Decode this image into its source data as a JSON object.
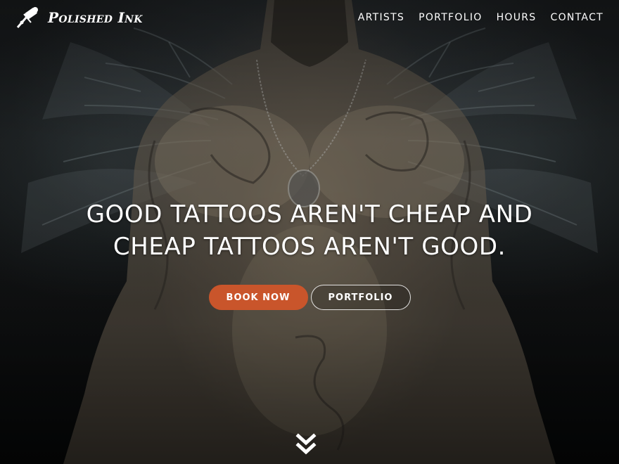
{
  "brand": {
    "name": "Polished Ink",
    "icon": "tattoo-machine-icon"
  },
  "nav": {
    "items": [
      {
        "label": "ARTISTS"
      },
      {
        "label": "PORTFOLIO"
      },
      {
        "label": "HOURS"
      },
      {
        "label": "CONTACT"
      }
    ]
  },
  "hero": {
    "headline_line1": "GOOD TATTOOS AREN'T CHEAP AND",
    "headline_line2": "CHEAP TATTOOS AREN'T GOOD.",
    "primary_button": "BOOK NOW",
    "secondary_button": "PORTFOLIO",
    "scroll_icon": "double-chevron-down-icon"
  },
  "colors": {
    "accent": "#c9552b",
    "text": "#ffffff",
    "background": "#0b0c0d"
  }
}
